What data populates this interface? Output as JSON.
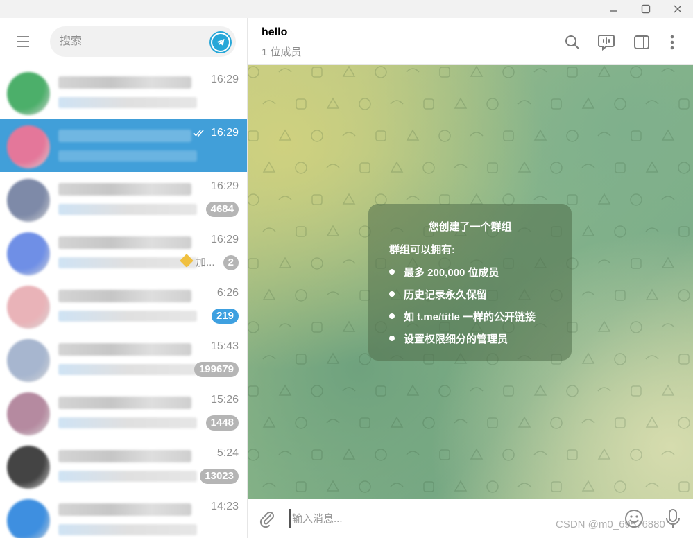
{
  "window": {
    "controls": [
      "minimize-icon",
      "maximize-icon",
      "close-icon"
    ]
  },
  "sidebar": {
    "search": {
      "placeholder": "搜索"
    },
    "chats": [
      {
        "time": "16:29",
        "badge": "",
        "avatar_color": "#4caf6a"
      },
      {
        "time": "16:29",
        "badge": "",
        "active": true,
        "read": true,
        "avatar_color": "#e4779a"
      },
      {
        "time": "16:29",
        "badge": "4684",
        "avatar_color": "#7e8aa8"
      },
      {
        "time": "16:29",
        "badge": "2",
        "extra": "加...",
        "avatar_color": "#6f8fe6"
      },
      {
        "time": "6:26",
        "badge": "219",
        "badge_blue": true,
        "avatar_color": "#e9b3b8"
      },
      {
        "time": "15:43",
        "badge": "199679",
        "avatar_color": "#a7b6cf"
      },
      {
        "time": "15:26",
        "badge": "1448",
        "avatar_color": "#b58aa0"
      },
      {
        "time": "5:24",
        "badge": "13023",
        "avatar_color": "#444444"
      },
      {
        "time": "14:23",
        "badge": "",
        "avatar_color": "#3e8fe0"
      }
    ]
  },
  "header": {
    "title": "hello",
    "subtitle": "1 位成员",
    "icons": [
      "search-icon",
      "voice-chat-icon",
      "sidebar-toggle-icon",
      "more-icon"
    ]
  },
  "service_message": {
    "title": "您创建了一个群组",
    "subtitle": "群组可以拥有:",
    "items": [
      "最多 200,000 位成员",
      "历史记录永久保留",
      "如 t.me/title 一样的公开链接",
      "设置权限细分的管理员"
    ]
  },
  "composer": {
    "placeholder": "输入消息...",
    "watermark": "CSDN @m0_69576880"
  },
  "colors": {
    "accent": "#419fd9",
    "telegram": "#27a7d8"
  }
}
